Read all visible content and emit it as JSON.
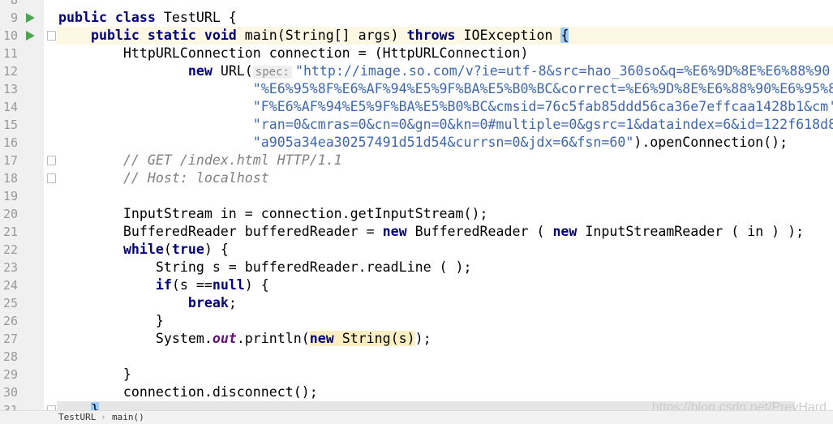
{
  "editor": {
    "lines": [
      {
        "n": 8,
        "t": []
      },
      {
        "n": 9,
        "run": true,
        "t": [
          [
            "kw",
            "public class "
          ],
          [
            "",
            "TestURL {"
          ]
        ]
      },
      {
        "n": 10,
        "run": true,
        "fold": true,
        "caret": true,
        "t": [
          [
            "",
            "    "
          ],
          [
            "kw",
            "public static void "
          ],
          [
            "",
            "main(String[] args) "
          ],
          [
            "kw",
            "throws "
          ],
          [
            "",
            "IOException "
          ],
          [
            "brace",
            "{"
          ]
        ]
      },
      {
        "n": 11,
        "t": [
          [
            "",
            "        HttpURLConnection connection = (HttpURLConnection)"
          ]
        ]
      },
      {
        "n": 12,
        "t": [
          [
            "",
            "                "
          ],
          [
            "kw",
            "new "
          ],
          [
            "",
            "URL("
          ],
          [
            "hint",
            "spec:"
          ],
          [
            "str",
            "\"http://image.so.com/v?ie=utf-8&src=hao_360so&q=%E6%9D%8E%E6%88%90"
          ]
        ]
      },
      {
        "n": 13,
        "t": [
          [
            "",
            "                        "
          ],
          [
            "str",
            "\"%E6%95%8F%E6%AF%94%E5%9F%BA%E5%B0%BC&correct=%E6%9D%8E%E6%88%90%E6%95%8"
          ]
        ]
      },
      {
        "n": 14,
        "t": [
          [
            "",
            "                        "
          ],
          [
            "str",
            "\"F%E6%AF%94%E5%9F%BA%E5%B0%BC&cmsid=76c5fab85ddd56ca36e7effcaa1428b1&cm'"
          ]
        ]
      },
      {
        "n": 15,
        "t": [
          [
            "",
            "                        "
          ],
          [
            "str",
            "\"ran=0&cmras=0&cn=0&gn=0&kn=0#multiple=0&gsrc=1&dataindex=6&id=122f618d8"
          ]
        ]
      },
      {
        "n": 16,
        "t": [
          [
            "",
            "                        "
          ],
          [
            "str",
            "\"a905a34ea30257491d51d54&currsn=0&jdx=6&fsn=60\""
          ],
          [
            "",
            ").openConnection();"
          ]
        ]
      },
      {
        "n": 17,
        "fold": true,
        "t": [
          [
            "",
            "        "
          ],
          [
            "cm",
            "// GET /index.html HTTP/1.1"
          ]
        ]
      },
      {
        "n": 18,
        "fold": true,
        "t": [
          [
            "",
            "        "
          ],
          [
            "cm",
            "// Host: localhost"
          ]
        ]
      },
      {
        "n": 19,
        "t": []
      },
      {
        "n": 20,
        "t": [
          [
            "",
            "        InputStream in = connection.getInputStream();"
          ]
        ]
      },
      {
        "n": 21,
        "t": [
          [
            "",
            "        BufferedReader bufferedReader = "
          ],
          [
            "kw",
            "new "
          ],
          [
            "",
            "BufferedReader ( "
          ],
          [
            "kw",
            "new "
          ],
          [
            "",
            "InputStreamReader ( in ) );"
          ]
        ]
      },
      {
        "n": 22,
        "t": [
          [
            "",
            "        "
          ],
          [
            "kw",
            "while"
          ],
          [
            "",
            "("
          ],
          [
            "kw",
            "true"
          ],
          [
            "",
            ") {"
          ]
        ]
      },
      {
        "n": 23,
        "t": [
          [
            "",
            "            String s = bufferedReader.readLine ( );"
          ]
        ]
      },
      {
        "n": 24,
        "t": [
          [
            "",
            "            "
          ],
          [
            "kw",
            "if"
          ],
          [
            "",
            "(s =="
          ],
          [
            "kw",
            "null"
          ],
          [
            "",
            ") {"
          ]
        ]
      },
      {
        "n": 25,
        "t": [
          [
            "",
            "                "
          ],
          [
            "kw",
            "break"
          ],
          [
            "",
            ";"
          ]
        ]
      },
      {
        "n": 26,
        "t": [
          [
            "",
            "            }"
          ]
        ]
      },
      {
        "n": 27,
        "t": [
          [
            "",
            "            System."
          ],
          [
            "fld",
            "out"
          ],
          [
            "",
            ".println("
          ],
          [
            "hlkw",
            "new "
          ],
          [
            "hl",
            "String(s)"
          ],
          [
            "",
            "); "
          ]
        ]
      },
      {
        "n": 28,
        "t": []
      },
      {
        "n": 29,
        "t": [
          [
            "",
            "        }"
          ]
        ]
      },
      {
        "n": 30,
        "t": [
          [
            "",
            "        connection.disconnect();"
          ]
        ]
      },
      {
        "n": 31,
        "sel": true,
        "fold": true,
        "t": [
          [
            "",
            "    "
          ],
          [
            "brace",
            "}"
          ]
        ]
      }
    ]
  },
  "breadcrumb": [
    "TestURL",
    "main()"
  ],
  "breadcrumb_sep": "›",
  "watermark": "https://blog.csdn.net/PreyHard"
}
